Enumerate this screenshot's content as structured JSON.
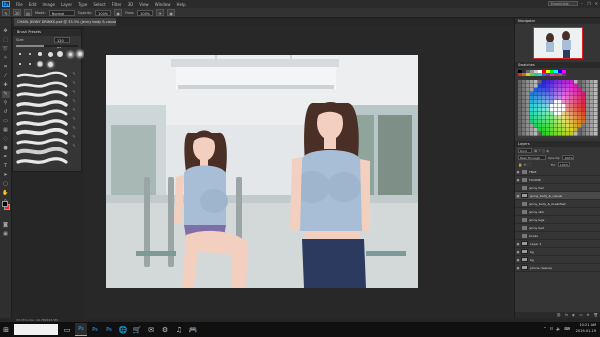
{
  "app": {
    "logo": "Ps"
  },
  "menu": [
    "File",
    "Edit",
    "Image",
    "Layer",
    "Type",
    "Select",
    "Filter",
    "3D",
    "View",
    "Window",
    "Help"
  ],
  "workspace": {
    "value": "Essentials"
  },
  "window_controls": [
    "–",
    "❐",
    "✕"
  ],
  "options": {
    "brush_size": "30",
    "mode_label": "Mode:",
    "mode_value": "Normal",
    "opacity_label": "Opacity:",
    "opacity_value": "100%",
    "flow_label": "Flow:",
    "flow_value": "100%"
  },
  "document": {
    "tab_title": "CHARL JENNY DRINKS.psd @ 33.3% (jenny body & casual, RGB/8) *",
    "status": "33.33%   Doc: 24.7M/593.5M"
  },
  "brush_presets": {
    "title": "Brush Presets",
    "size_label": "Size:",
    "size_value": "120 px",
    "size_fraction": 0.45
  },
  "panels": {
    "navigator_title": "Navigator",
    "swatches_title": "Swatches",
    "layers_title": "Layers"
  },
  "layers_toolbar": {
    "kind": "Kind",
    "blend": "Pass Through",
    "opacity_label": "Opacity:",
    "opacity_value": "100%",
    "fill_label": "Fill:",
    "fill_value": "100%"
  },
  "layers": [
    {
      "name": "TBLE",
      "kind": "folder",
      "visible": true
    },
    {
      "name": "TLOOSE",
      "kind": "folder",
      "visible": true
    },
    {
      "name": "jenny hair",
      "kind": "folder",
      "visible": false
    },
    {
      "name": "jenny_body_&_casual",
      "kind": "layer",
      "visible": true,
      "selected": true
    },
    {
      "name": "jenny_body_&_breakfast",
      "kind": "folder",
      "visible": false
    },
    {
      "name": "jenny skin",
      "kind": "folder",
      "visible": false
    },
    {
      "name": "jenny legs",
      "kind": "folder",
      "visible": false
    },
    {
      "name": "jenny bed",
      "kind": "folder",
      "visible": false
    },
    {
      "name": "books",
      "kind": "folder",
      "visible": false
    },
    {
      "name": "Layer 1",
      "kind": "layer",
      "visible": true
    },
    {
      "name": "bg",
      "kind": "layer",
      "visible": true
    },
    {
      "name": "bg",
      "kind": "layer",
      "visible": true
    },
    {
      "name": "phone cleanup",
      "kind": "layer",
      "visible": true
    }
  ],
  "taskbar": {
    "apps": [
      "Ps",
      "Ps",
      "Ps",
      "🌐",
      "🛒",
      "✉",
      "⚙",
      "♫",
      "🎮"
    ],
    "time": "10:21 AM",
    "date": "2019-01-19"
  },
  "colors": {
    "accent": "#31a8ff",
    "foreground": "#000000",
    "background": "#ff2020"
  }
}
